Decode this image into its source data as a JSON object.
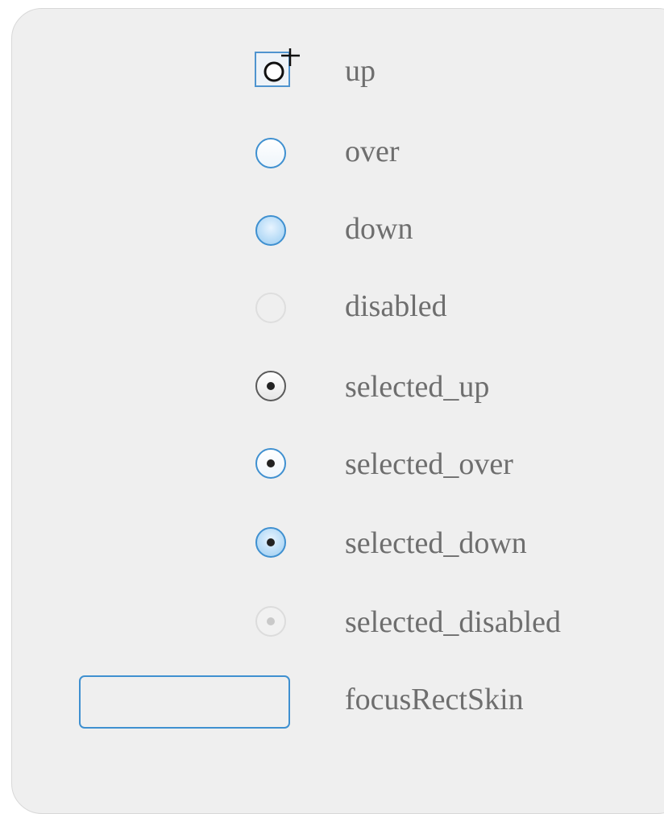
{
  "states": [
    {
      "key": "up",
      "label": "up",
      "icon": "radio-up-cursor-icon"
    },
    {
      "key": "over",
      "label": "over",
      "icon": "radio-over-icon"
    },
    {
      "key": "down",
      "label": "down",
      "icon": "radio-down-icon"
    },
    {
      "key": "disabled",
      "label": "disabled",
      "icon": "radio-disabled-icon"
    },
    {
      "key": "selected_up",
      "label": "selected_up",
      "icon": "radio-selected-up-icon"
    },
    {
      "key": "selected_over",
      "label": "selected_over",
      "icon": "radio-selected-over-icon"
    },
    {
      "key": "selected_down",
      "label": "selected_down",
      "icon": "radio-selected-down-icon"
    },
    {
      "key": "selected_disabled",
      "label": "selected_disabled",
      "icon": "radio-selected-disabled-icon"
    },
    {
      "key": "focusRectSkin",
      "label": "focusRectSkin",
      "icon": "focus-rect-icon"
    }
  ],
  "colors": {
    "panel_background": "#efefef",
    "label_text": "#6e6e6e",
    "accent_blue": "#3f90d0",
    "dot": "#222222"
  }
}
